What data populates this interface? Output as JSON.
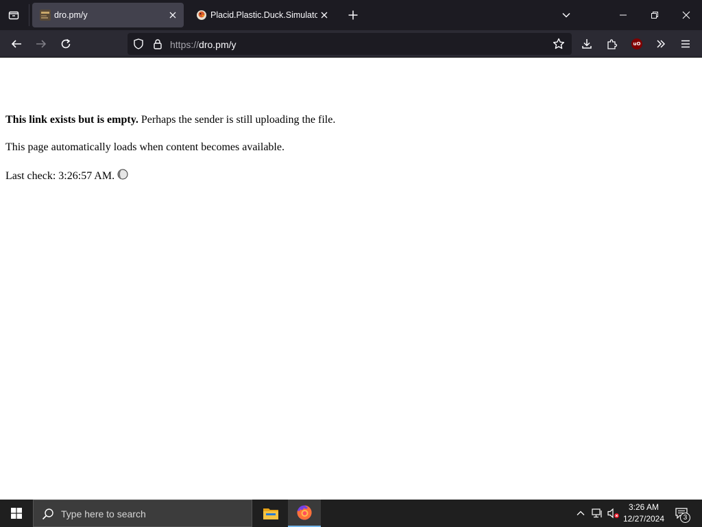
{
  "browser": {
    "tabs": [
      {
        "title": "dro.pm/y",
        "active": true,
        "favicon": "dro-pm-favicon-icon"
      },
      {
        "title": "Placid.Plastic.Duck.Simulator.D",
        "active": false,
        "favicon": "duck-favicon-icon"
      }
    ],
    "url": {
      "protocol": "https://",
      "rest": "dro.pm/y"
    },
    "icons": {
      "list_all_tabs": "tab-list-icon",
      "new_tab": "plus-icon",
      "tab_dropdown": "chevron-down-icon",
      "minimize": "minimize-icon",
      "restore": "restore-icon",
      "close": "close-icon",
      "back": "arrow-left-icon",
      "forward": "arrow-right-icon",
      "reload": "reload-icon",
      "tracking_protection": "shield-icon",
      "secure": "lock-icon",
      "bookmark": "star-icon",
      "downloads": "download-icon",
      "extensions": "puzzle-icon",
      "ublock": "ublock-origin-icon",
      "overflow": "chevron-double-right-icon",
      "menu": "hamburger-menu-icon"
    },
    "ublock_label": "uO"
  },
  "page": {
    "line1_bold": "This link exists but is empty.",
    "line1_rest": " Perhaps the sender is still uploading the file.",
    "line2": "This page automatically loads when content becomes available.",
    "line3": "Last check: 3:26:57 AM."
  },
  "taskbar": {
    "search_placeholder": "Type here to search",
    "time": "3:26 AM",
    "date": "12/27/2024",
    "notification_count": "3",
    "apps": [
      "file-explorer-icon",
      "firefox-icon"
    ],
    "accent_color": "#76b9ed"
  }
}
